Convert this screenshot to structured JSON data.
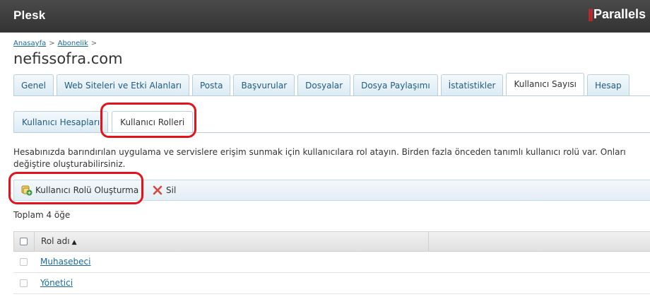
{
  "app": {
    "brand": "Plesk",
    "vendor": "Parallels",
    "vendor_mark": "||"
  },
  "breadcrumb": {
    "items": [
      "Anasayfa",
      "Abonelik"
    ],
    "sep": ">"
  },
  "page": {
    "title": "nefissofra.com"
  },
  "tabs": [
    {
      "label": "Genel",
      "active": false
    },
    {
      "label": "Web Siteleri ve Etki Alanları",
      "active": false
    },
    {
      "label": "Posta",
      "active": false
    },
    {
      "label": "Başvurular",
      "active": false
    },
    {
      "label": "Dosyalar",
      "active": false
    },
    {
      "label": "Dosya Paylaşımı",
      "active": false
    },
    {
      "label": "İstatistikler",
      "active": false
    },
    {
      "label": "Kullanıcı Sayısı",
      "active": true
    },
    {
      "label": "Hesap",
      "active": false
    }
  ],
  "subtabs": [
    {
      "label": "Kullanıcı Hesapları",
      "active": false
    },
    {
      "label": "Kullanıcı Rolleri",
      "active": true
    }
  ],
  "description": "Hesabınızda barındırılan uygulama ve servislere erişim sunmak için kullanıcılara rol atayın. Birden fazla önceden tanımlı kullanıcı rolü var. Onları değiştire oluşturabilirsiniz.",
  "toolbar": {
    "create_label": "Kullanıcı Rolü Oluşturma",
    "create_icon": "add-role-icon",
    "delete_label": "Sil",
    "delete_icon": "delete-icon"
  },
  "list": {
    "total": "Toplam 4 öğe",
    "column_header": "Rol adı",
    "sort_indicator": "▲",
    "rows": [
      {
        "name": "Muhasebeci"
      },
      {
        "name": "Yönetici"
      }
    ]
  },
  "colors": {
    "topbar": "#3b3b3b",
    "link": "#1a6a9c",
    "highlight": "#e3121b",
    "vendor_accent": "#d0242b"
  }
}
